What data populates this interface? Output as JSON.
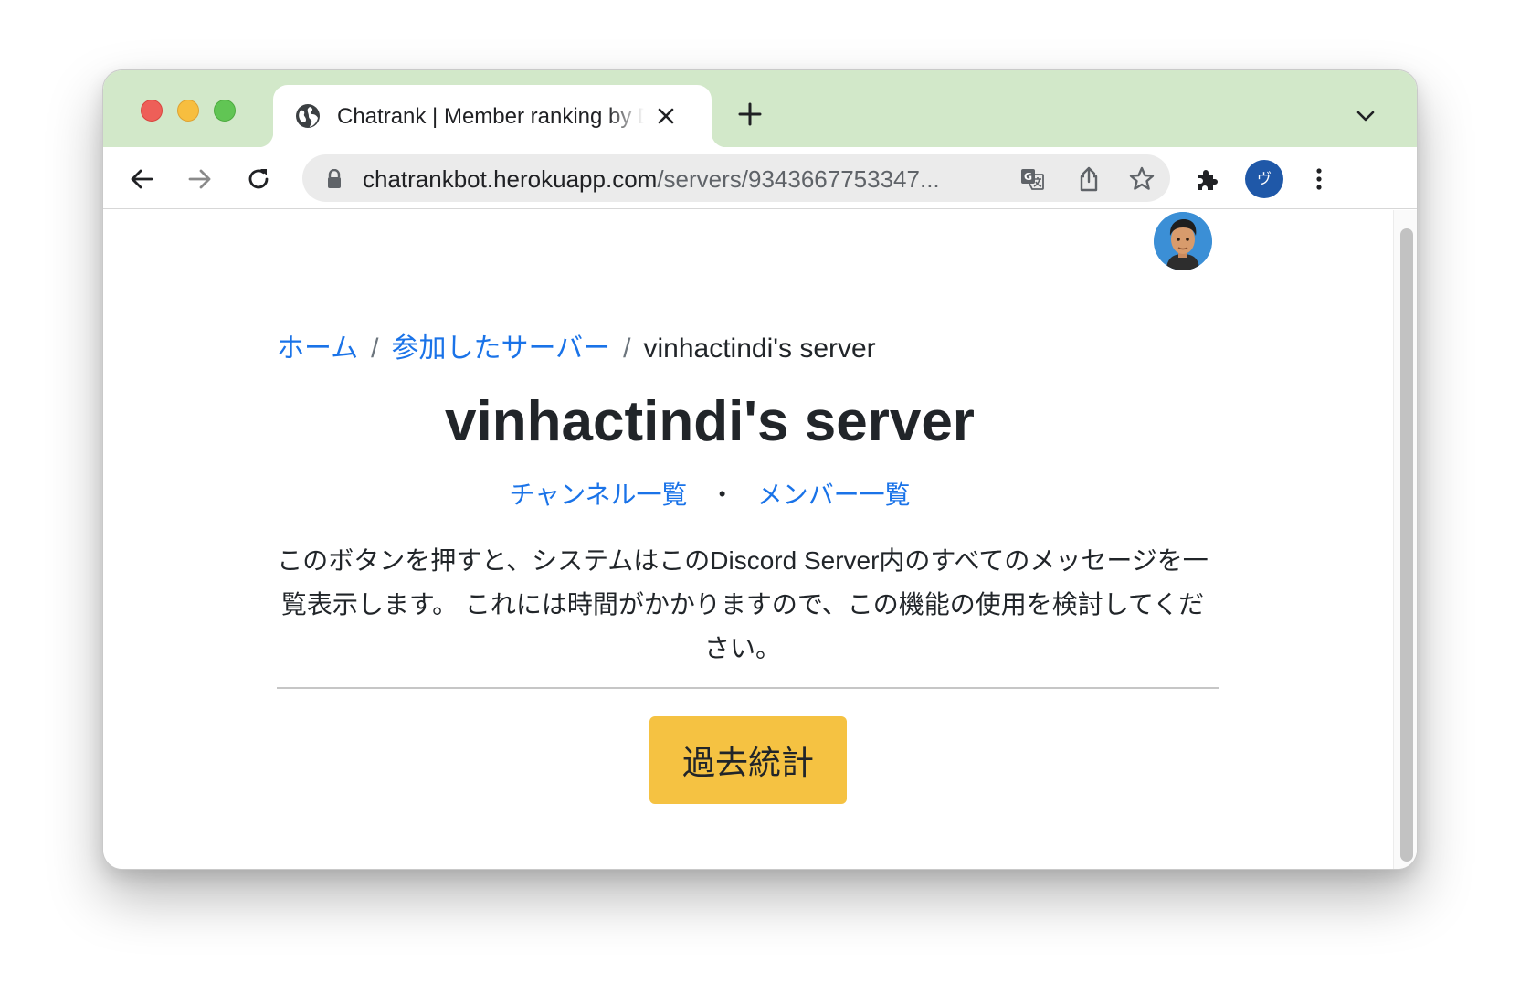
{
  "browser": {
    "tab": {
      "title": "Chatrank | Member ranking by Discord"
    },
    "url": {
      "host": "chatrankbot.herokuapp.com",
      "path": "/servers/9343667753347..."
    },
    "profile_initial": "ヴ"
  },
  "page": {
    "breadcrumb": {
      "home": "ホーム",
      "joined_servers": "参加したサーバー",
      "current": "vinhactindi's server",
      "separator": "/"
    },
    "title": "vinhactindi's server",
    "links": {
      "channels": "チャンネル一覧",
      "dot": "・",
      "members": "メンバー一覧"
    },
    "description": "このボタンを押すと、システムはこのDiscord Server内のすべてのメッセージを一覧表示します。 これには時間がかかりますので、この機能の使用を検討してください。",
    "button_label": "過去統計"
  },
  "colors": {
    "tabstrip": "#d2e8c9",
    "link": "#1a73e8",
    "button": "#f5c242"
  }
}
